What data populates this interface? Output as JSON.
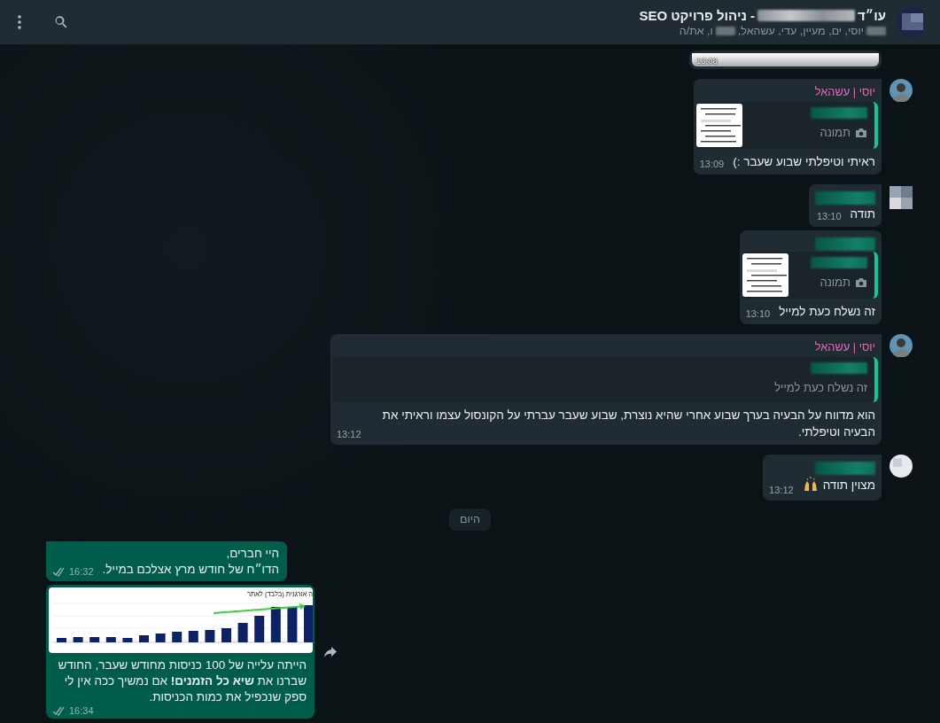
{
  "header": {
    "title_segments": [
      {
        "kind": "text",
        "text": "עו״ד"
      },
      {
        "kind": "redacted"
      },
      {
        "kind": "text",
        "text": "- ניהול פרויקט SEO"
      }
    ],
    "member_segments": [
      {
        "kind": "redacted"
      },
      {
        "kind": "text",
        "text": "יוסי, ים, מעיין, עדי, עשהאל,"
      },
      {
        "kind": "redacted"
      },
      {
        "kind": "text",
        "text": "ו, את/ה"
      }
    ]
  },
  "messages": [
    {
      "kind": "image_tail",
      "outgoing": false,
      "tail": false,
      "time": "13:08"
    },
    {
      "kind": "text",
      "outgoing": false,
      "tail": true,
      "sender": "יוסי | עשהאל",
      "quote": {
        "label": "תמונה"
      },
      "text": "ראיתי וטיפלתי שבוע שעבר :)",
      "time": "13:09"
    },
    {
      "kind": "text",
      "outgoing": false,
      "tail": true,
      "avatar": {
        "kind": "blurred"
      },
      "sender_redacted": true,
      "text": "תודה",
      "time": "13:10"
    },
    {
      "kind": "text",
      "outgoing": false,
      "tail": false,
      "sender_redacted": true,
      "quote": {
        "label": "תמונה"
      },
      "text": "זה נשלח כעת למייל",
      "time": "13:10"
    },
    {
      "kind": "text",
      "outgoing": false,
      "tail": true,
      "sender": "יוסי | עשהאל",
      "quote": {
        "kind": "text",
        "label": "זה נשלח כעת למייל"
      },
      "text": "הוא מדווח על הבעיה בערך שבוע אחרי שהיא נוצרת, שבוע שעבר עברתי על הקונסול עצמו וראיתי את הבעיה וטיפלתי.",
      "time": "13:12"
    },
    {
      "kind": "text",
      "outgoing": false,
      "tail": true,
      "avatar": {
        "kind": "blurred-light"
      },
      "sender_redacted": true,
      "text": "מצוין תודה",
      "emoji": {
        "kind": "raised-hands"
      },
      "time": "13:12"
    },
    {
      "kind": "date",
      "label": "היום"
    },
    {
      "kind": "text",
      "outgoing": true,
      "tail": true,
      "text": "היי חברים,\nהדו״ח של חודש מרץ אצלכם במייל.",
      "time": "16:32",
      "read": false
    },
    {
      "kind": "chart_image",
      "outgoing": true,
      "tail": false,
      "image_title": "ה אורגנית (בלבד) לאתר",
      "text": "הייתה עלייה של 100 כניסות מחודש שעבר, החודש שברנו את **שיא כל הזמנים!** אם נמשיך ככה אין לי ספק שנכפיל את כמות הכניסות.",
      "time": "16:34",
      "read": false,
      "forward": true
    }
  ]
}
